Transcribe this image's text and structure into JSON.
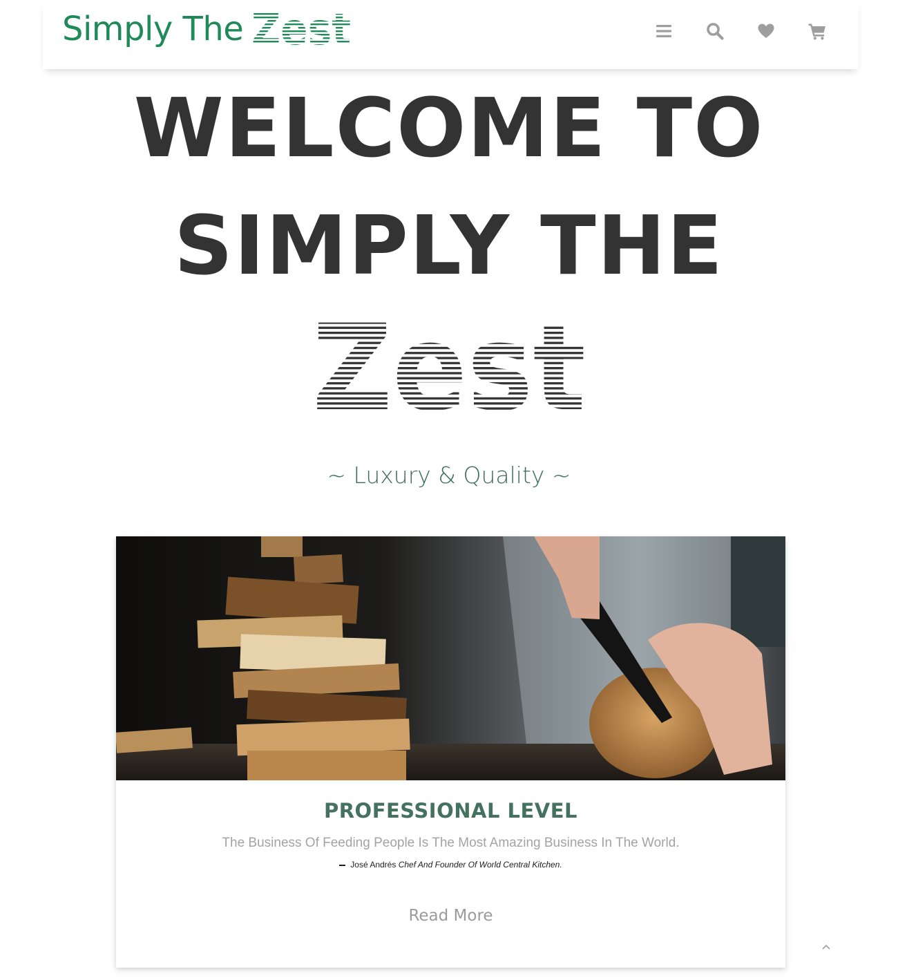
{
  "header": {
    "brand_text": "Simply The",
    "brand_stylized": "Zest",
    "icons": [
      "menu-icon",
      "search-icon",
      "heart-icon",
      "cart-icon"
    ],
    "brand_color": "#1f8a57",
    "icon_color": "#9e9e9e"
  },
  "hero": {
    "line1": "WELCOME TO",
    "line2": "SIMPLY THE",
    "stylized_word": "Zest",
    "tagline": "~ Luxury & Quality ~",
    "text_color": "#333333",
    "tagline_color": "#3b6e57"
  },
  "card": {
    "image": "bread-cutting-photo",
    "title": "PROFESSIONAL LEVEL",
    "quote": "The Business Of Feeding People Is The Most Amazing Business In The World.",
    "author": "José Andrés",
    "author_role": "Chef And Founder Of World Central Kitchen.",
    "read_more": "Read More",
    "title_color": "#44725f"
  },
  "footer": {
    "back_to_top_icon": "chevron-up-icon"
  }
}
